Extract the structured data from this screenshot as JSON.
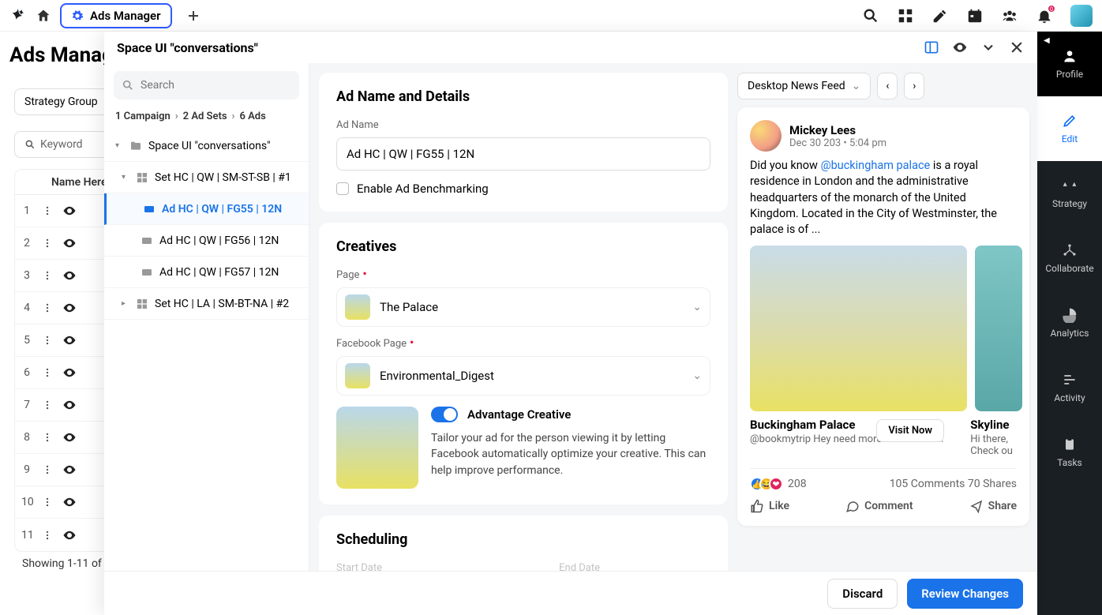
{
  "topbar": {
    "tab_label": "Ads Manager",
    "notif_count": "0"
  },
  "page_title": "Ads Manager",
  "filters": {
    "strategy_group": "Strategy Group",
    "keyword_placeholder": "Keyword"
  },
  "table": {
    "header": "Name Here",
    "rows": [
      "1",
      "2",
      "3",
      "4",
      "5",
      "6",
      "7",
      "8",
      "9",
      "10",
      "11"
    ],
    "showing": "Showing 1-11 of"
  },
  "drawer": {
    "title": "Space UI \"conversations\"",
    "search_placeholder": "Search",
    "crumbs": {
      "campaigns": "1 Campaign",
      "adsets": "2 Ad Sets",
      "ads": "6 Ads"
    },
    "tree": {
      "root": "Space UI \"conversations\"",
      "set1": "Set HC | QW | SM-ST-SB | #1",
      "ad1": "Ad HC | QW | FG55 | 12N",
      "ad2": "Ad HC | QW | FG56 | 12N",
      "ad3": "Ad HC | QW | FG57 | 12N",
      "set2": "Set HC | LA | SM-BT-NA | #2"
    }
  },
  "form": {
    "section1_title": "Ad Name and Details",
    "ad_name_label": "Ad Name",
    "ad_name_value": "Ad HC | QW | FG55 | 12N",
    "benchmark_label": "Enable Ad Benchmarking",
    "section2_title": "Creatives",
    "page_label": "Page",
    "page_value": "The Palace",
    "fbpage_label": "Facebook Page",
    "fbpage_value": "Environmental_Digest",
    "adv_title": "Advantage Creative",
    "adv_desc": "Tailor your ad for the person viewing it by letting Facebook automatically optimize your creative. This can help improve performance.",
    "section3_title": "Scheduling",
    "start_label": "Start Date",
    "end_label": "End Date"
  },
  "preview": {
    "placement": "Desktop News Feed",
    "name": "Mickey Lees",
    "time": "Dec 30 203 • 5:04 pm",
    "text_pre": "Did you know ",
    "text_link": "@buckingham palace",
    "text_post": " is a royal residence in London and the administrative headquarters of the monarch of the United Kingdom. Located in the City of Westminster, the palace is of ...",
    "card1_title": "Buckingham Palace",
    "card1_sub": "@bookmytrip Hey need more info how to...",
    "card2_title": "Skyline",
    "card2_sub": "Hi there, Check ou",
    "visit_btn": "Visit  Now",
    "react_count": "208",
    "comments": "105 Comments",
    "shares": "70 Shares",
    "like": "Like",
    "comment": "Comment",
    "share": "Share"
  },
  "footer": {
    "discard": "Discard",
    "review": "Review Changes"
  },
  "rail": {
    "profile": "Profile",
    "edit": "Edit",
    "strategy": "Strategy",
    "collaborate": "Collaborate",
    "analytics": "Analytics",
    "activity": "Activity",
    "tasks": "Tasks"
  }
}
